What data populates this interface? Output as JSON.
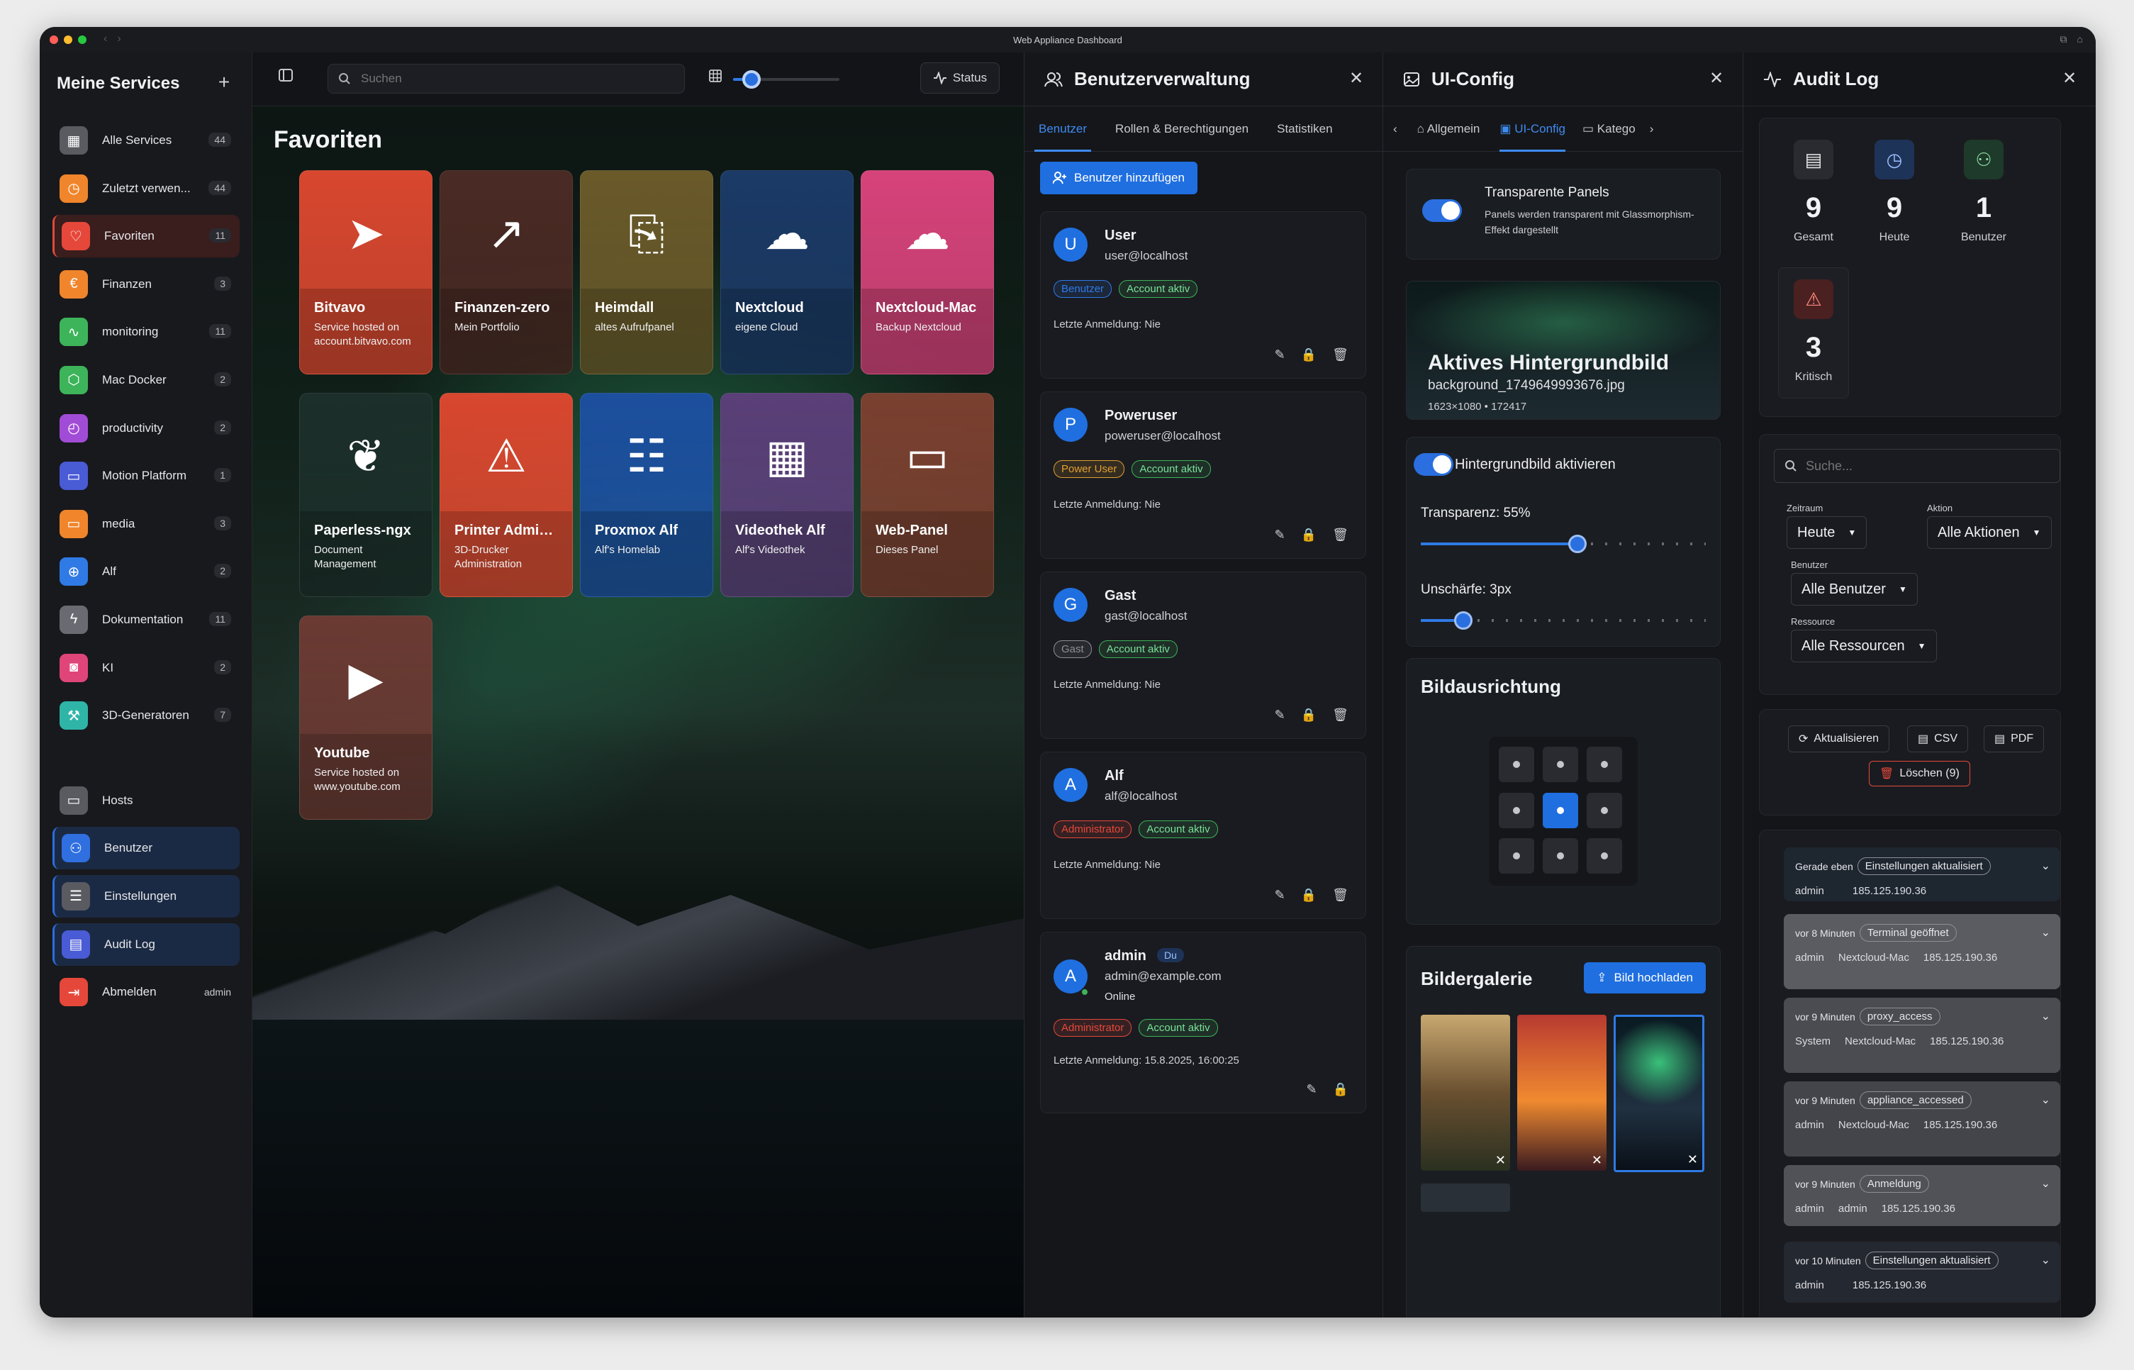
{
  "window_title": "Web Appliance Dashboard",
  "sidebar": {
    "title": "Meine Services",
    "items": [
      {
        "label": "Alle Services",
        "count": "44",
        "icon": "grid-icon",
        "color": "#5a5b61"
      },
      {
        "label": "Zuletzt verwen...",
        "count": "44",
        "icon": "clock-icon",
        "color": "#f0852b"
      },
      {
        "label": "Favoriten",
        "count": "11",
        "icon": "heart-icon",
        "color": "#e5483a"
      },
      {
        "label": "Finanzen",
        "count": "3",
        "icon": "euro-icon",
        "color": "#f0852b"
      },
      {
        "label": "monitoring",
        "count": "11",
        "icon": "activity-icon",
        "color": "#3db45a"
      },
      {
        "label": "Mac Docker",
        "count": "2",
        "icon": "box-icon",
        "color": "#3db45a"
      },
      {
        "label": "productivity",
        "count": "2",
        "icon": "timer-icon",
        "color": "#a14cd6"
      },
      {
        "label": "Motion Platform",
        "count": "1",
        "icon": "folder-icon",
        "color": "#4a5bd6"
      },
      {
        "label": "media",
        "count": "3",
        "icon": "monitor-icon",
        "color": "#f0852b"
      },
      {
        "label": "Alf",
        "count": "2",
        "icon": "globe-icon",
        "color": "#2f7ae5"
      },
      {
        "label": "Dokumentation",
        "count": "11",
        "icon": "bolt-icon",
        "color": "#6a6b72"
      },
      {
        "label": "KI",
        "count": "2",
        "icon": "camera-icon",
        "color": "#e0457a"
      },
      {
        "label": "3D-Generatoren",
        "count": "7",
        "icon": "wrench-icon",
        "color": "#2fb5a8"
      }
    ],
    "bottom": [
      {
        "label": "Hosts",
        "icon": "monitor-icon",
        "color": "#5a5b61",
        "extra": ""
      },
      {
        "label": "Benutzer",
        "icon": "users-icon",
        "color": "#2f6fe0",
        "extra": ""
      },
      {
        "label": "Einstellungen",
        "icon": "sliders-icon",
        "color": "#5a5b61",
        "extra": ""
      },
      {
        "label": "Audit Log",
        "icon": "document-icon",
        "color": "#4a5bd6",
        "extra": ""
      },
      {
        "label": "Abmelden",
        "icon": "logout-icon",
        "color": "#e5483a",
        "extra": "admin"
      }
    ]
  },
  "main": {
    "search_placeholder": "Suchen",
    "status_label": "Status",
    "zoom_level": 0.17,
    "section_title": "Favoriten",
    "tiles": [
      {
        "name": "Bitvavo",
        "desc": "Service hosted on account.bitvavo.com",
        "icon": "send-icon",
        "color": "#d8472f"
      },
      {
        "name": "Finanzen-zero",
        "desc": "Mein Portfolio",
        "icon": "trending-up-icon",
        "color": "#4a2a24"
      },
      {
        "name": "Heimdall",
        "desc": "altes Aufrufpanel",
        "icon": "clipboard-export-icon",
        "color": "#6a5a2a"
      },
      {
        "name": "Nextcloud",
        "desc": "eigene Cloud",
        "icon": "cloud-icon",
        "color": "#1b3a66"
      },
      {
        "name": "Nextcloud-Mac",
        "desc": "Backup Nextcloud",
        "icon": "cloud-icon",
        "color": "#d6437a"
      },
      {
        "name": "Paperless-ngx",
        "desc": "Document Management",
        "icon": "leaf-icon",
        "color": "#1c2f2a"
      },
      {
        "name": "Printer Admin...",
        "desc": "3D-Drucker Administration",
        "icon": "warning-icon",
        "color": "#d8472f"
      },
      {
        "name": "Proxmox Alf",
        "desc": "Alf's Homelab",
        "icon": "server-icon",
        "color": "#1c4f9e"
      },
      {
        "name": "Videothek Alf",
        "desc": "Alf's Videothek",
        "icon": "film-icon",
        "color": "#5a3f78"
      },
      {
        "name": "Web-Panel",
        "desc": "Dieses Panel",
        "icon": "window-icon",
        "color": "#7a4030"
      },
      {
        "name": "Youtube",
        "desc": "Service hosted on www.youtube.com",
        "icon": "play-icon",
        "color": "#6a3a33"
      }
    ]
  },
  "users_panel": {
    "title": "Benutzerverwaltung",
    "tabs": [
      "Benutzer",
      "Rollen & Berechtigungen",
      "Statistiken"
    ],
    "add_button": "Benutzer hinzufügen",
    "users": [
      {
        "initial": "U",
        "name": "User",
        "email": "user@localhost",
        "role": "Benutzer",
        "role_color": "#2f7ae5",
        "status": "Account aktiv",
        "last_login": "Letzte Anmeldung: Nie",
        "you": "",
        "online": ""
      },
      {
        "initial": "P",
        "name": "Poweruser",
        "email": "poweruser@localhost",
        "role": "Power User",
        "role_color": "#e0a030",
        "status": "Account aktiv",
        "last_login": "Letzte Anmeldung: Nie",
        "you": "",
        "online": ""
      },
      {
        "initial": "G",
        "name": "Gast",
        "email": "gast@localhost",
        "role": "Gast",
        "role_color": "#8e8e95",
        "status": "Account aktiv",
        "last_login": "Letzte Anmeldung: Nie",
        "you": "",
        "online": ""
      },
      {
        "initial": "A",
        "name": "Alf",
        "email": "alf@localhost",
        "role": "Administrator",
        "role_color": "#e5483a",
        "status": "Account aktiv",
        "last_login": "Letzte Anmeldung: Nie",
        "you": "",
        "online": ""
      },
      {
        "initial": "A",
        "name": "admin",
        "email": "admin@example.com",
        "role": "Administrator",
        "role_color": "#e5483a",
        "status": "Account aktiv",
        "last_login": "Letzte Anmeldung: 15.8.2025, 16:00:25",
        "you": "Du",
        "online": "Online"
      }
    ]
  },
  "uiconfig_panel": {
    "title": "UI-Config",
    "tabs": [
      "Allgemein",
      "UI-Config",
      "Katego"
    ],
    "transparent_title": "Transparente Panels",
    "transparent_desc": "Panels werden transparent mit Glassmorphism-Effekt dargestellt",
    "bg_title": "Aktives Hintergrundbild",
    "bg_file": "background_1749649993676.jpg",
    "bg_meta": "1623×1080 • 172417",
    "bg_enable": "Hintergrundbild aktivieren",
    "transparency_label": "Transparenz: 55%",
    "transparency_value": 0.55,
    "blur_label": "Unschärfe: 3px",
    "blur_value": 0.15,
    "alignment_title": "Bildausrichtung",
    "alignment_selected": 4,
    "gallery_title": "Bildergalerie",
    "upload_button": "Bild hochladen"
  },
  "audit_panel": {
    "title": "Audit Log",
    "stats": [
      {
        "value": "9",
        "label": "Gesamt",
        "icon": "document-icon",
        "bg": "#2a2b30",
        "fg": "#e8e8ea"
      },
      {
        "value": "9",
        "label": "Heute",
        "icon": "clock-icon",
        "bg": "#1e3358",
        "fg": "#9cc0ff"
      },
      {
        "value": "1",
        "label": "Benutzer",
        "icon": "users-icon",
        "bg": "#1e3a2a",
        "fg": "#8ee0a8"
      },
      {
        "value": "3",
        "label": "Kritisch",
        "icon": "warning-icon",
        "bg": "#4a2020",
        "fg": "#ff8a80"
      }
    ],
    "search_placeholder": "Suche...",
    "filters": {
      "zeitraum_label": "Zeitraum",
      "zeitraum_value": "Heute",
      "aktion_label": "Aktion",
      "aktion_value": "Alle Aktionen",
      "benutzer_label": "Benutzer",
      "benutzer_value": "Alle Benutzer",
      "ressource_label": "Ressource",
      "ressource_value": "Alle Ressourcen"
    },
    "buttons": {
      "refresh": "Aktualisieren",
      "csv": "CSV",
      "pdf": "PDF",
      "delete": "Löschen (9)"
    },
    "entries": [
      {
        "time": "Gerade eben",
        "action": "Einstellungen aktualisiert",
        "user": "admin",
        "resource": "",
        "ip": "185.125.190.36"
      },
      {
        "time": "vor 8 Minuten",
        "action": "Terminal geöffnet",
        "user": "admin",
        "resource": "Nextcloud-Mac",
        "ip": "185.125.190.36"
      },
      {
        "time": "vor 9 Minuten",
        "action": "proxy_access",
        "user": "System",
        "resource": "Nextcloud-Mac",
        "ip": "185.125.190.36"
      },
      {
        "time": "vor 9 Minuten",
        "action": "appliance_accessed",
        "user": "admin",
        "resource": "Nextcloud-Mac",
        "ip": "185.125.190.36"
      },
      {
        "time": "vor 9 Minuten",
        "action": "Anmeldung",
        "user": "admin",
        "resource": "admin",
        "ip": "185.125.190.36"
      },
      {
        "time": "vor 10 Minuten",
        "action": "Einstellungen aktualisiert",
        "user": "admin",
        "resource": "",
        "ip": "185.125.190.36"
      }
    ]
  }
}
